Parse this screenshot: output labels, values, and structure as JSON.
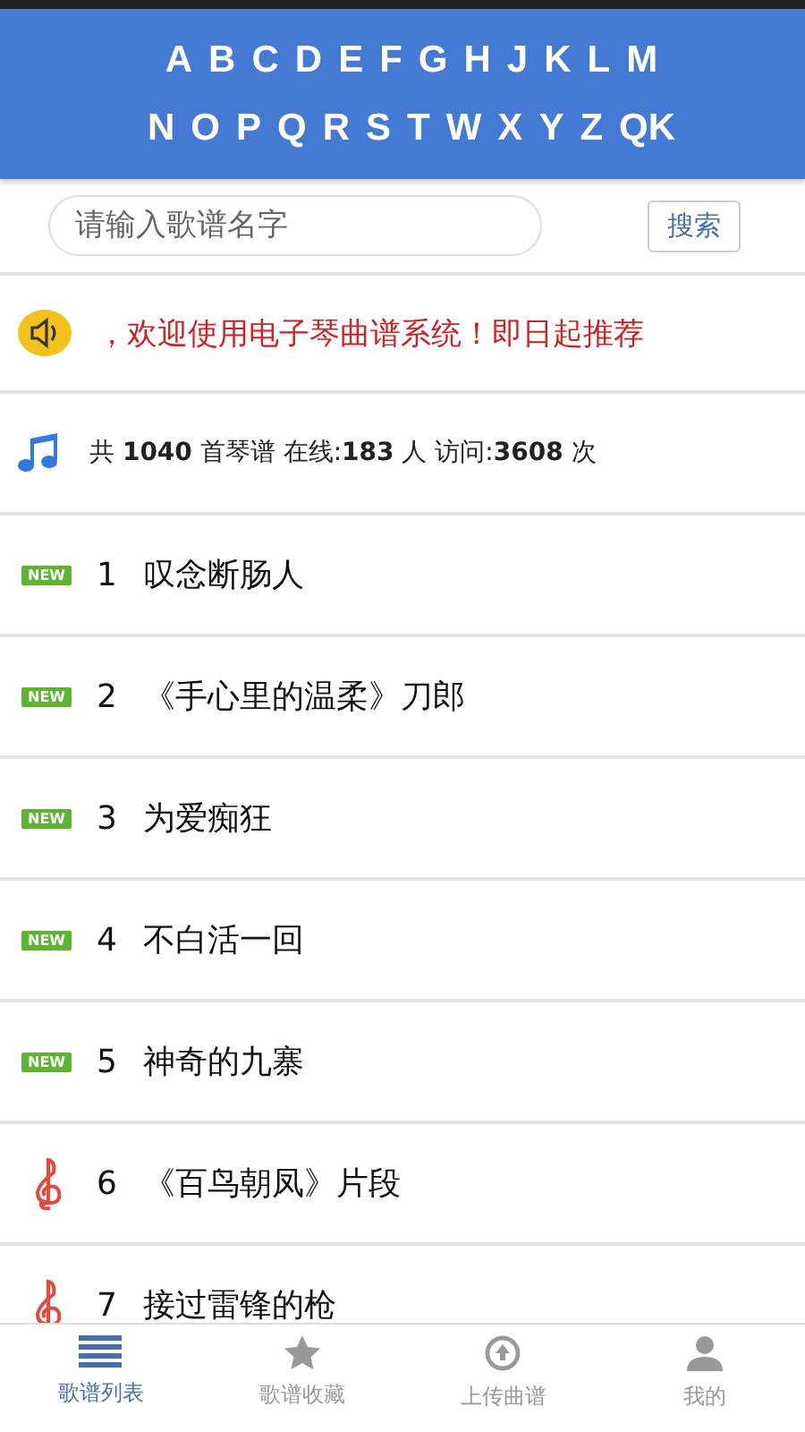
{
  "letters": [
    [
      "A",
      "B",
      "C",
      "D",
      "E",
      "F",
      "G",
      "H",
      "J",
      "K",
      "L",
      "M"
    ],
    [
      "N",
      "O",
      "P",
      "Q",
      "R",
      "S",
      "T",
      "W",
      "X",
      "Y",
      "Z",
      "QK"
    ]
  ],
  "search": {
    "placeholder": "请输入歌谱名字",
    "button": "搜索"
  },
  "notice": "，欢迎使用电子琴曲谱系统！即日起推荐",
  "stats": "共 **1040** 首琴谱 在线:**183** 人 访问:**3608** 次",
  "songs": [
    {
      "kind": "new",
      "badge": "NEW",
      "number": "1",
      "title": "叹念断肠人"
    },
    {
      "kind": "new",
      "badge": "NEW",
      "number": "2",
      "title": "《手心里的温柔》刀郎"
    },
    {
      "kind": "new",
      "badge": "NEW",
      "number": "3",
      "title": "为爱痴狂"
    },
    {
      "kind": "new",
      "badge": "NEW",
      "number": "4",
      "title": "不白活一回"
    },
    {
      "kind": "new",
      "badge": "NEW",
      "number": "5",
      "title": "神奇的九寨"
    },
    {
      "kind": "clef",
      "number": "6",
      "title": "《百鸟朝凤》片段"
    },
    {
      "kind": "clef",
      "number": "7",
      "title": "接过雷锋的枪"
    }
  ],
  "nav": [
    {
      "label": "歌谱列表",
      "selected": true
    },
    {
      "label": "歌谱收藏",
      "selected": false
    },
    {
      "label": "上传曲谱",
      "selected": false
    },
    {
      "label": "我的",
      "selected": false
    }
  ]
}
